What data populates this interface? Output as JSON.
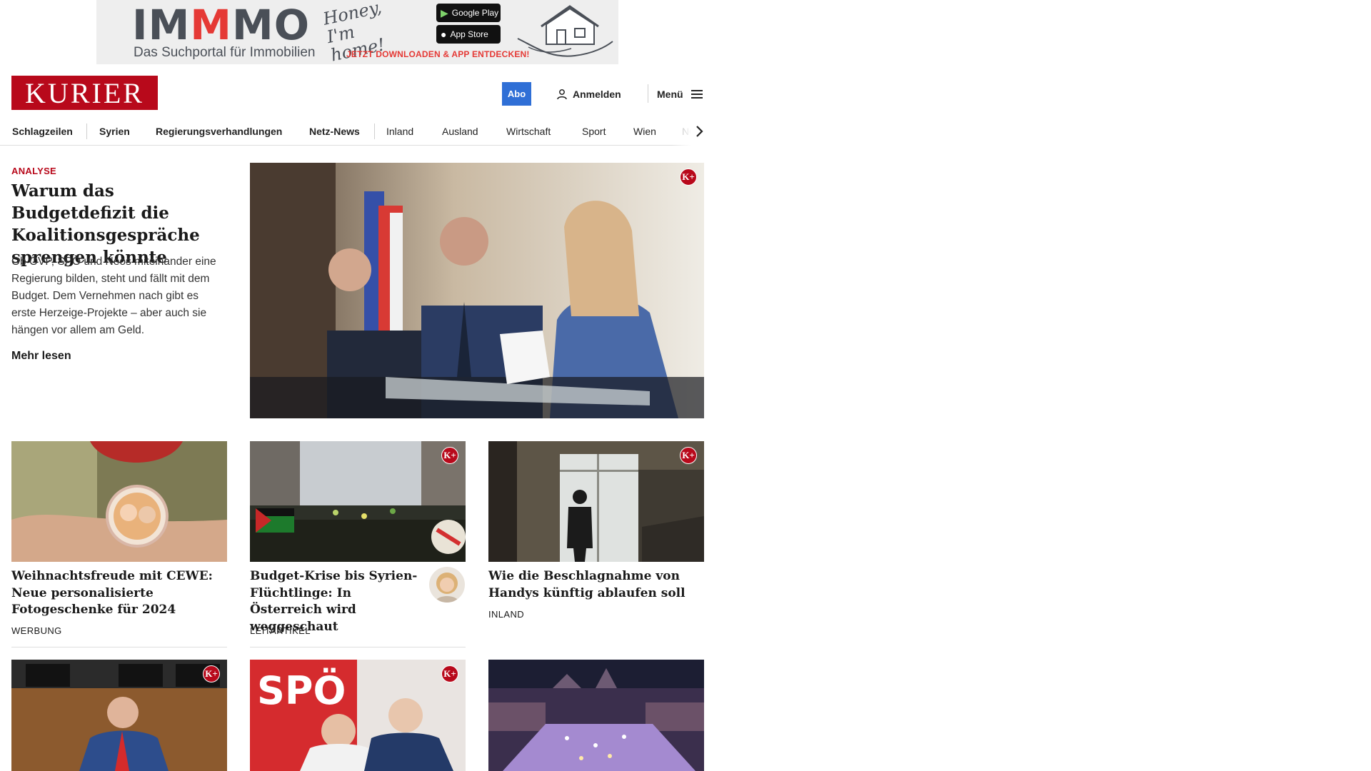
{
  "ad": {
    "brand_pre": "IM",
    "brand_mid": "M",
    "brand_post": "MO",
    "tagline": "Das Suchportal für Immobilien",
    "handwriting": "Honey, I'm home!",
    "google_play": "Google Play",
    "app_store": "App Store",
    "cta": "JETZT DOWNLOADEN & APP ENTDECKEN!"
  },
  "header": {
    "logo": "KURIER",
    "abo": "Abo",
    "login": "Anmelden",
    "menu": "Menü"
  },
  "nav": {
    "items": [
      "Schlagzeilen",
      "Syrien",
      "Regierungsverhandlungen",
      "Netz-News",
      "Inland",
      "Ausland",
      "Wirtschaft",
      "Sport",
      "Wien",
      "NÖ"
    ]
  },
  "lead": {
    "kicker": "ANALYSE",
    "title": "Warum das Budgetdefizit die Koalitionsgespräche sprengen könnte",
    "text": "Ob ÖVP, SPÖ und Neos miteinander eine Regierung bilden, steht und fällt mit dem Budget. Dem Vernehmen nach gibt es erste Herzeige-Projekte – aber auch sie hängen vor allem am Geld.",
    "more": "Mehr lesen",
    "badge": "K+"
  },
  "cards": [
    {
      "title": "Weihnachtsfreude mit CEWE: Neue personalisierte Fotogeschenke für 2024",
      "category": "WERBUNG"
    },
    {
      "title": "Budget-Krise bis Syrien-Flüchtlinge: In Österreich wird weggeschaut",
      "category": "LEITARTIKEL",
      "badge": "K+"
    },
    {
      "title": "Wie die Beschlagnahme von Handys künftig ablaufen soll",
      "category": "INLAND",
      "badge": "K+"
    }
  ],
  "bottom_cards": [
    {
      "badge": "K+"
    },
    {
      "badge": "K+",
      "sign": "SPÖ"
    },
    {}
  ],
  "colors": {
    "brand_red": "#b8091b",
    "abo_blue": "#2f6fd6",
    "ad_red": "#e53935"
  }
}
